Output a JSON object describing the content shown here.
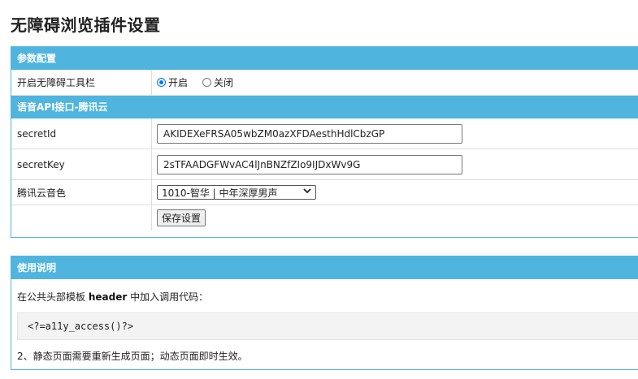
{
  "page": {
    "title": "无障碍浏览插件设置"
  },
  "config": {
    "header": "参数配置",
    "toolbar_row": {
      "label": "开启无障碍工具栏",
      "options": [
        {
          "label": "开启",
          "checked": true
        },
        {
          "label": "关闭",
          "checked": false
        }
      ]
    }
  },
  "api": {
    "header": "语音API接口-腾讯云",
    "secret_id": {
      "label": "secretId",
      "value": "AKIDEXeFRSA05wbZM0azXFDAesthHdlCbzGP"
    },
    "secret_key": {
      "label": "secretKey",
      "value": "2sTFAADGFWvAC4lJnBNZfZIo9IJDxWv9G"
    },
    "voice": {
      "label": "腾讯云音色",
      "selected": "1010-智华 | 中年深厚男声"
    },
    "save_label": "保存设置"
  },
  "usage": {
    "header": "使用说明",
    "line1_prefix": "在公共头部模板 ",
    "line1_bold": "header",
    "line1_suffix": " 中加入调用代码：",
    "code": "<?=a11y_access()?>",
    "note": "2、静态页面需要重新生成页面；动态页面即时生效。"
  },
  "colors": {
    "accent": "#4fb5de",
    "radio_checked": "#0075ff"
  }
}
